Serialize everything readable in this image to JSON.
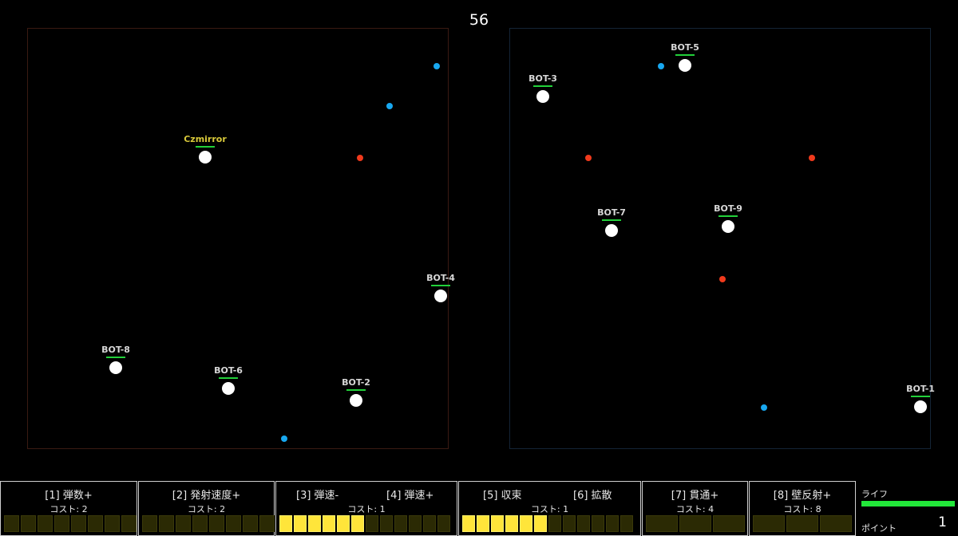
{
  "timer": "56",
  "player": {
    "name": "Czmirror"
  },
  "bots": [
    "BOT-1",
    "BOT-2",
    "BOT-3",
    "BOT-4",
    "BOT-5",
    "BOT-6",
    "BOT-7",
    "BOT-8",
    "BOT-9"
  ],
  "upgrades": [
    {
      "label": "[1] 弾数+",
      "cost": "コスト: 2"
    },
    {
      "label": "[2] 発射速度+",
      "cost": "コスト: 2"
    },
    {
      "label": "[3] 弾速-",
      "label2": "[4] 弾速+",
      "cost": "コスト: 1",
      "level": 6,
      "cells": 12
    },
    {
      "label": "[5] 収束",
      "label2": "[6] 拡散",
      "cost": "コスト: 1",
      "level": 6,
      "cells": 12
    },
    {
      "label": "[7] 貫通+",
      "cost": "コスト: 4"
    },
    {
      "label": "[8] 壁反射+",
      "cost": "コスト: 8"
    }
  ],
  "status": {
    "life_label": "ライフ",
    "life_fraction": 1.0,
    "points_label": "ポイント",
    "points": "1"
  },
  "colors": {
    "player_name": "#d8c93a",
    "hp_bar": "#22d13a",
    "bullet_player": "#18a8f0",
    "bullet_enemy": "#f03a1c",
    "upgrade_on": "#ffe53a",
    "upgrade_off": "#2b2a04"
  }
}
